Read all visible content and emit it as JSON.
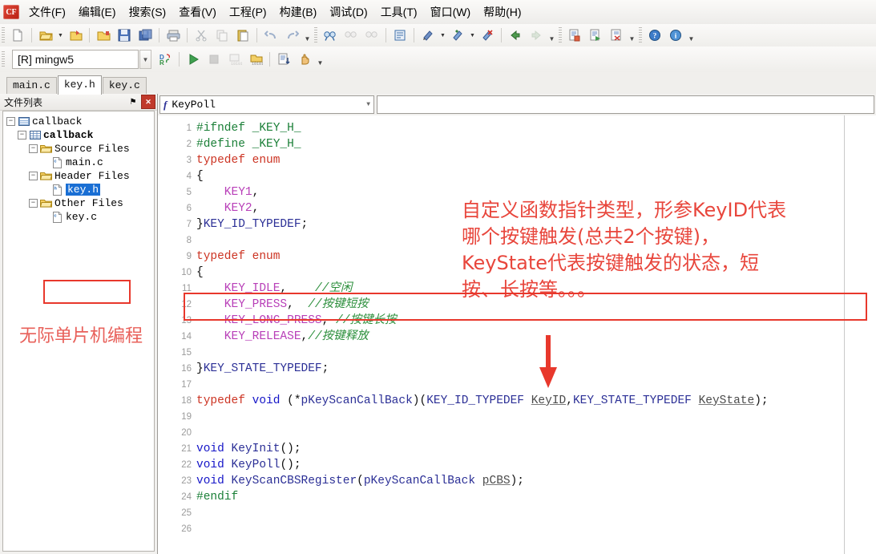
{
  "app": {
    "logo_text": "CF",
    "logo_name": "dev-cpp-logo"
  },
  "menubar": {
    "items": [
      {
        "label": "文件(F)",
        "name": "menu-file"
      },
      {
        "label": "编辑(E)",
        "name": "menu-edit"
      },
      {
        "label": "搜索(S)",
        "name": "menu-search"
      },
      {
        "label": "查看(V)",
        "name": "menu-view"
      },
      {
        "label": "工程(P)",
        "name": "menu-project"
      },
      {
        "label": "构建(B)",
        "name": "menu-build"
      },
      {
        "label": "调试(D)",
        "name": "menu-debug"
      },
      {
        "label": "工具(T)",
        "name": "menu-tools"
      },
      {
        "label": "窗口(W)",
        "name": "menu-window"
      },
      {
        "label": "帮助(H)",
        "name": "menu-help"
      }
    ]
  },
  "toolbar": {
    "compiler": {
      "value": "[R] mingw5",
      "name": "compiler-select"
    }
  },
  "tabs": {
    "items": [
      {
        "label": "main.c",
        "active": false
      },
      {
        "label": "key.h",
        "active": true
      },
      {
        "label": "key.c",
        "active": false
      }
    ]
  },
  "left_panel": {
    "title": "文件列表",
    "pin_label": "⚑",
    "close_label": "✕",
    "tree": [
      {
        "label": "callback",
        "depth": 0,
        "icon": "workspace-icon",
        "bold": false,
        "selected": false,
        "expander": "−"
      },
      {
        "label": "callback",
        "depth": 1,
        "icon": "project-icon",
        "bold": true,
        "selected": false,
        "expander": "−"
      },
      {
        "label": "Source Files",
        "depth": 2,
        "icon": "folder-icon",
        "bold": false,
        "selected": false,
        "expander": "−"
      },
      {
        "label": "main.c",
        "depth": 3,
        "icon": "c-file-icon",
        "bold": false,
        "selected": false,
        "expander": ""
      },
      {
        "label": "Header Files",
        "depth": 2,
        "icon": "folder-icon",
        "bold": false,
        "selected": false,
        "expander": "−"
      },
      {
        "label": "key.h",
        "depth": 3,
        "icon": "h-file-icon",
        "bold": false,
        "selected": true,
        "expander": ""
      },
      {
        "label": "Other Files",
        "depth": 2,
        "icon": "folder-icon",
        "bold": false,
        "selected": false,
        "expander": "−"
      },
      {
        "label": "key.c",
        "depth": 3,
        "icon": "c-file-icon",
        "bold": false,
        "selected": false,
        "expander": ""
      }
    ]
  },
  "editor": {
    "function_combo": {
      "value": "KeyPoll",
      "icon_label": "f"
    },
    "lines": [
      {
        "n": "1",
        "segments": [
          {
            "t": "#ifndef _KEY_H_",
            "c": "pre"
          }
        ]
      },
      {
        "n": "2",
        "segments": [
          {
            "t": "#define _KEY_H_",
            "c": "pre"
          }
        ]
      },
      {
        "n": "3",
        "segments": [
          {
            "t": "typedef enum",
            "c": "kw"
          }
        ]
      },
      {
        "n": "4",
        "segments": [
          {
            "t": "{",
            "c": "pun"
          }
        ]
      },
      {
        "n": "5",
        "segments": [
          {
            "t": "    KEY1",
            "c": "enumv"
          },
          {
            "t": ",",
            "c": "pun"
          }
        ]
      },
      {
        "n": "6",
        "segments": [
          {
            "t": "    KEY2",
            "c": "enumv"
          },
          {
            "t": ",",
            "c": "pun"
          }
        ]
      },
      {
        "n": "7",
        "segments": [
          {
            "t": "}",
            "c": "pun"
          },
          {
            "t": "KEY_ID_TYPEDEF",
            "c": "tname"
          },
          {
            "t": ";",
            "c": "pun"
          }
        ]
      },
      {
        "n": "8",
        "segments": []
      },
      {
        "n": "9",
        "segments": [
          {
            "t": "typedef enum",
            "c": "kw"
          }
        ]
      },
      {
        "n": "10",
        "segments": [
          {
            "t": "{",
            "c": "pun"
          }
        ]
      },
      {
        "n": "11",
        "segments": [
          {
            "t": "    KEY_IDLE",
            "c": "enumv"
          },
          {
            "t": ",    ",
            "c": "pun"
          },
          {
            "t": "//空闲",
            "c": "cmt"
          }
        ]
      },
      {
        "n": "12",
        "segments": [
          {
            "t": "    KEY_PRESS",
            "c": "enumv"
          },
          {
            "t": ",  ",
            "c": "pun"
          },
          {
            "t": "//按键短按",
            "c": "cmt"
          }
        ]
      },
      {
        "n": "13",
        "segments": [
          {
            "t": "    KEY_LONG_PRESS",
            "c": "enumv"
          },
          {
            "t": ", ",
            "c": "pun"
          },
          {
            "t": "//按键长按",
            "c": "cmt"
          }
        ]
      },
      {
        "n": "14",
        "segments": [
          {
            "t": "    KEY_RELEASE",
            "c": "enumv"
          },
          {
            "t": ",",
            "c": "pun"
          },
          {
            "t": "//按键释放",
            "c": "cmt"
          }
        ]
      },
      {
        "n": "15",
        "segments": []
      },
      {
        "n": "16",
        "segments": [
          {
            "t": "}",
            "c": "pun"
          },
          {
            "t": "KEY_STATE_TYPEDEF",
            "c": "tname"
          },
          {
            "t": ";",
            "c": "pun"
          }
        ]
      },
      {
        "n": "17",
        "segments": []
      },
      {
        "n": "18",
        "segments": [
          {
            "t": "typedef ",
            "c": "kw"
          },
          {
            "t": "void",
            "c": "kwb"
          },
          {
            "t": " (*",
            "c": "pun"
          },
          {
            "t": "pKeyScanCallBack",
            "c": "ident"
          },
          {
            "t": ")(",
            "c": "pun"
          },
          {
            "t": "KEY_ID_TYPEDEF",
            "c": "tname"
          },
          {
            "t": " ",
            "c": "pun"
          },
          {
            "t": "KeyID",
            "c": "spell"
          },
          {
            "t": ",",
            "c": "pun"
          },
          {
            "t": "KEY_STATE_TYPEDEF",
            "c": "tname"
          },
          {
            "t": " ",
            "c": "pun"
          },
          {
            "t": "KeyState",
            "c": "spell"
          },
          {
            "t": ");",
            "c": "pun"
          }
        ]
      },
      {
        "n": "19",
        "segments": []
      },
      {
        "n": "20",
        "segments": []
      },
      {
        "n": "21",
        "segments": [
          {
            "t": "void",
            "c": "kwb"
          },
          {
            "t": " ",
            "c": "pun"
          },
          {
            "t": "KeyInit",
            "c": "ident"
          },
          {
            "t": "();",
            "c": "pun"
          }
        ]
      },
      {
        "n": "22",
        "segments": [
          {
            "t": "void",
            "c": "kwb"
          },
          {
            "t": " ",
            "c": "pun"
          },
          {
            "t": "KeyPoll",
            "c": "ident"
          },
          {
            "t": "();",
            "c": "pun"
          }
        ]
      },
      {
        "n": "23",
        "segments": [
          {
            "t": "void",
            "c": "kwb"
          },
          {
            "t": " ",
            "c": "pun"
          },
          {
            "t": "KeyScanCBSRegister",
            "c": "ident"
          },
          {
            "t": "(",
            "c": "pun"
          },
          {
            "t": "pKeyScanCallBack",
            "c": "ident"
          },
          {
            "t": " ",
            "c": "pun"
          },
          {
            "t": "pCBS",
            "c": "spell"
          },
          {
            "t": ");",
            "c": "pun"
          }
        ]
      },
      {
        "n": "24",
        "segments": [
          {
            "t": "#endif",
            "c": "pre"
          }
        ]
      },
      {
        "n": "25",
        "segments": []
      },
      {
        "n": "26",
        "segments": []
      }
    ]
  },
  "annotations": {
    "note_lines": [
      "自定义函数指针类型，形参KeyID代表",
      "哪个按键触发(总共2个按键)，",
      "KeyState代表按键触发的状态，短",
      "按、长按等。。。"
    ],
    "watermark": "无际单片机编程",
    "accent_color": "#e8382c",
    "note_color": "#e8463c"
  }
}
